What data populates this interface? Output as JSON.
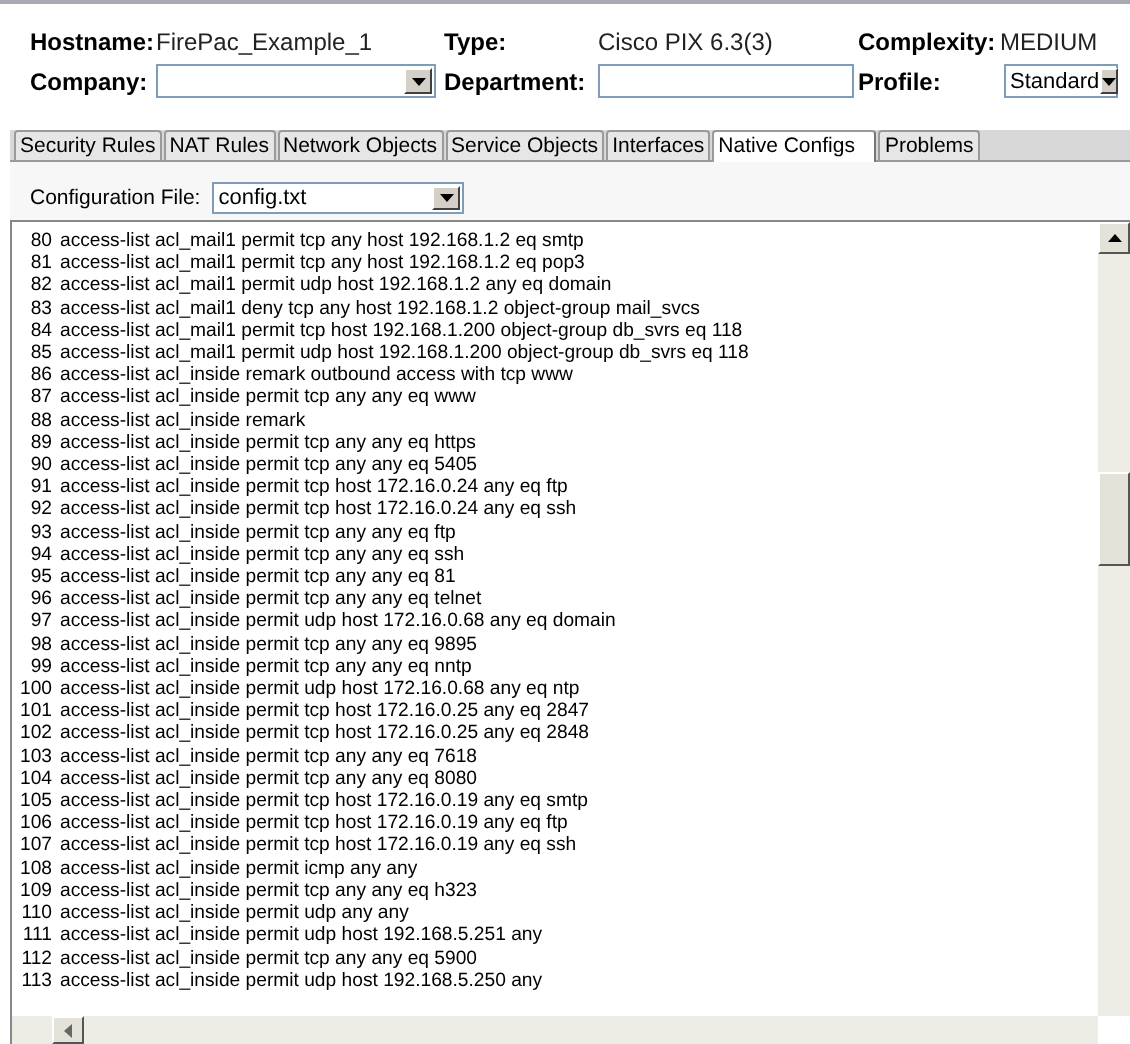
{
  "header": {
    "fields": [
      {
        "label": "Hostname:",
        "value": "FirePac_Example_1"
      },
      {
        "label": "Type:",
        "value": "Cisco PIX 6.3(3)"
      },
      {
        "label": "Complexity:",
        "value": "MEDIUM"
      }
    ],
    "controls": [
      {
        "label": "Company:",
        "kind": "combo"
      },
      {
        "label": "Department:",
        "kind": "text"
      },
      {
        "label": "Profile:",
        "kind": "select",
        "value": "Standard"
      }
    ]
  },
  "tabs": [
    {
      "label": "Security Rules",
      "selected": false
    },
    {
      "label": "NAT Rules",
      "selected": false
    },
    {
      "label": "Network Objects",
      "selected": false
    },
    {
      "label": "Service Objects",
      "selected": false
    },
    {
      "label": "Interfaces",
      "selected": false
    },
    {
      "label": "Native Configs",
      "selected": true
    },
    {
      "label": "Problems",
      "selected": false
    }
  ],
  "config_file": {
    "label": "Configuration File:",
    "value": "config.txt"
  },
  "lines": [
    {
      "number": "80",
      "text": "access-list acl_mail1 permit tcp any host 192.168.1.2 eq smtp"
    },
    {
      "number": "81",
      "text": "access-list acl_mail1 permit tcp any host 192.168.1.2 eq pop3"
    },
    {
      "number": "82",
      "text": "access-list acl_mail1 permit udp host 192.168.1.2 any eq domain"
    },
    {
      "number": "83",
      "text": "access-list acl_mail1 deny tcp any host 192.168.1.2 object-group mail_svcs"
    },
    {
      "number": "84",
      "text": "access-list acl_mail1 permit tcp host 192.168.1.200 object-group db_svrs eq 118"
    },
    {
      "number": "85",
      "text": "access-list acl_mail1 permit udp host 192.168.1.200 object-group db_svrs eq 118"
    },
    {
      "number": "86",
      "text": "access-list acl_inside remark outbound access with tcp www"
    },
    {
      "number": "87",
      "text": "access-list acl_inside permit tcp any any eq www"
    },
    {
      "number": "88",
      "text": "access-list acl_inside remark"
    },
    {
      "number": "89",
      "text": "access-list acl_inside permit tcp any any eq https"
    },
    {
      "number": "90",
      "text": "access-list acl_inside permit tcp any any eq 5405"
    },
    {
      "number": "91",
      "text": "access-list acl_inside permit tcp host 172.16.0.24 any eq ftp"
    },
    {
      "number": "92",
      "text": "access-list acl_inside permit tcp host 172.16.0.24 any eq ssh"
    },
    {
      "number": "93",
      "text": "access-list acl_inside permit tcp any any eq ftp"
    },
    {
      "number": "94",
      "text": "access-list acl_inside permit tcp any any eq ssh"
    },
    {
      "number": "95",
      "text": "access-list acl_inside permit tcp any any eq 81"
    },
    {
      "number": "96",
      "text": "access-list acl_inside permit tcp any any eq telnet"
    },
    {
      "number": "97",
      "text": "access-list acl_inside permit udp host 172.16.0.68 any eq domain"
    },
    {
      "number": "98",
      "text": "access-list acl_inside permit tcp any any eq 9895"
    },
    {
      "number": "99",
      "text": "access-list acl_inside permit tcp any any eq nntp"
    },
    {
      "number": "100",
      "text": "access-list acl_inside permit udp host 172.16.0.68 any eq ntp"
    },
    {
      "number": "101",
      "text": "access-list acl_inside permit tcp host 172.16.0.25 any eq 2847"
    },
    {
      "number": "102",
      "text": "access-list acl_inside permit tcp host 172.16.0.25 any eq 2848"
    },
    {
      "number": "103",
      "text": "access-list acl_inside permit tcp any any eq 7618"
    },
    {
      "number": "104",
      "text": "access-list acl_inside permit tcp any any eq 8080"
    },
    {
      "number": "105",
      "text": "access-list acl_inside permit tcp host 172.16.0.19 any eq smtp"
    },
    {
      "number": "106",
      "text": "access-list acl_inside permit tcp host 172.16.0.19 any eq ftp"
    },
    {
      "number": "107",
      "text": "access-list acl_inside permit tcp host 172.16.0.19 any eq ssh"
    },
    {
      "number": "108",
      "text": "access-list acl_inside permit icmp any any"
    },
    {
      "number": "109",
      "text": "access-list acl_inside permit tcp any any eq h323"
    },
    {
      "number": "110",
      "text": "access-list acl_inside permit udp any any"
    },
    {
      "number": "111",
      "text": "access-list acl_inside permit udp host 192.168.5.251 any"
    },
    {
      "number": "112",
      "text": "access-list acl_inside permit tcp any any eq 5900"
    },
    {
      "number": "113",
      "text": "access-list acl_inside permit udp host 192.168.5.250 any"
    }
  ]
}
